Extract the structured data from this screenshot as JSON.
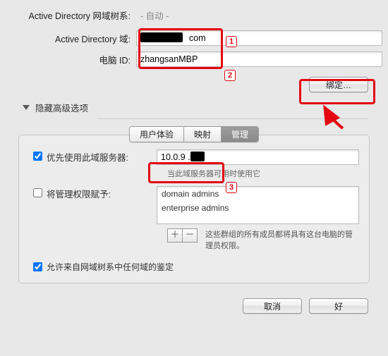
{
  "form": {
    "forest_label": "Active Directory 网域树系:",
    "forest_value": "- 自动 -",
    "domain_label": "Active Directory 域:",
    "domain_value": "com",
    "computer_id_label": "电脑 ID:",
    "computer_id_value": "zhangsanMBP"
  },
  "bind_button": "绑定…",
  "disclosure_label": "隐藏高级选项",
  "tabs": {
    "ux": "用户体验",
    "mapping": "映射",
    "admin": "管理"
  },
  "admin": {
    "prefer_server_label": "优先使用此域服务器:",
    "prefer_server_value": "10.0.9 .",
    "prefer_server_help": "当此域服务器可用时使用它",
    "grant_admin_label": "将管理权限赋予:",
    "admin_groups": [
      "domain admins",
      "enterprise admins"
    ],
    "add_btn": "＋",
    "remove_btn": "－",
    "groups_help": "这些群组的所有成员都将具有这台电脑的管理员权限。",
    "allow_any_domain_label": "允许来自网域树系中任何域的鉴定"
  },
  "footer": {
    "cancel": "取消",
    "ok": "好"
  },
  "callouts": {
    "c1": "1",
    "c2": "2",
    "c3": "3"
  }
}
